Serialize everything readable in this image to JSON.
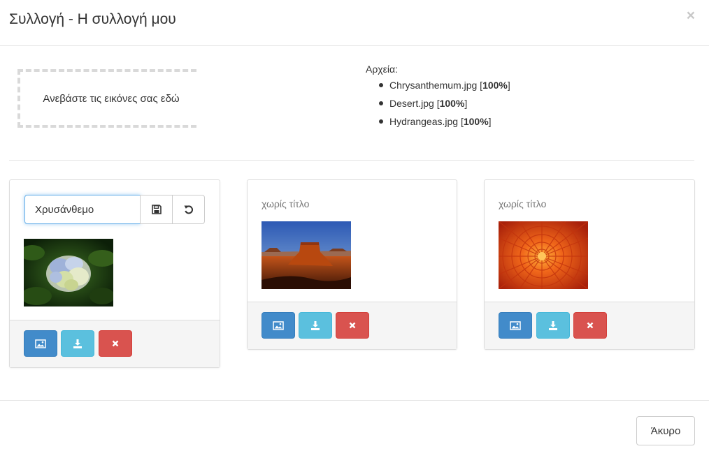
{
  "modal": {
    "title": "Συλλογή - Η συλλογή μου",
    "close_symbol": "×"
  },
  "upload": {
    "dropzone_label": "Ανεβάστε τις εικόνες σας εδώ",
    "files_label": "Αρχεία:",
    "files": [
      {
        "name": "Chrysanthemum.jpg",
        "progress": "100%"
      },
      {
        "name": "Desert.jpg",
        "progress": "100%"
      },
      {
        "name": "Hydrangeas.jpg",
        "progress": "100%"
      }
    ]
  },
  "cards": [
    {
      "title_input_value": "Χρυσάνθεμο",
      "image": "hydrangea-photo",
      "actions": [
        "image-icon",
        "download-icon",
        "delete-icon"
      ]
    },
    {
      "title": "χωρίς τίτλο",
      "image": "desert-photo",
      "actions": [
        "image-icon",
        "download-icon",
        "delete-icon"
      ]
    },
    {
      "title": "χωρίς τίτλο",
      "image": "chrysanthemum-photo",
      "actions": [
        "image-icon",
        "download-icon",
        "delete-icon"
      ]
    }
  ],
  "title_editor_icons": [
    "save-icon",
    "undo-icon"
  ],
  "footer": {
    "cancel_label": "Άκυρο"
  },
  "colors": {
    "primary": "#428bca",
    "info": "#5bc0de",
    "danger": "#d9534f",
    "input_focus": "#66afe9"
  }
}
